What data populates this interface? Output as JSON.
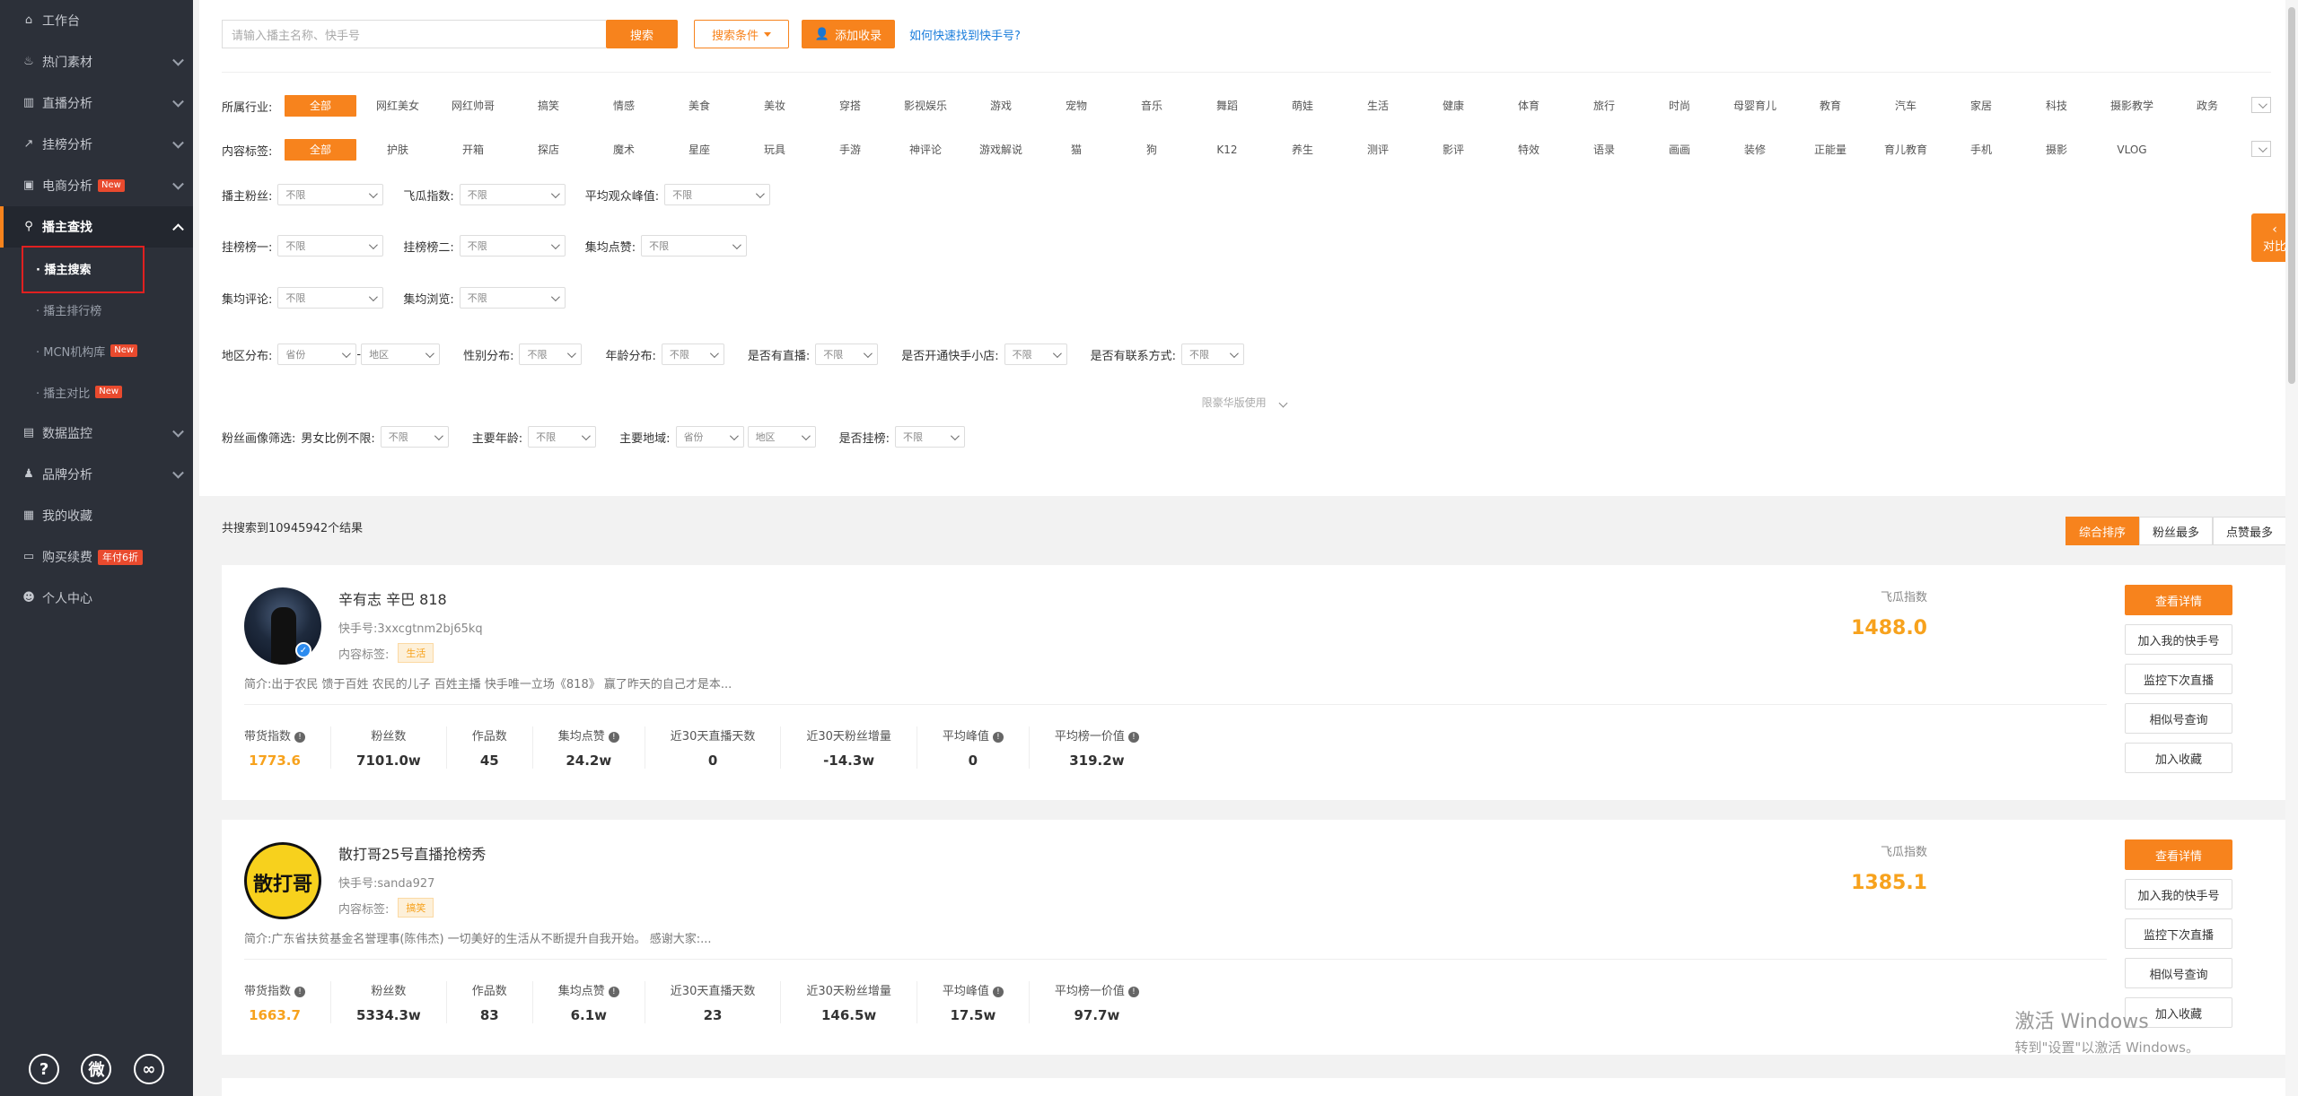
{
  "sidebar": {
    "items": [
      {
        "label": "工作台",
        "icon": "home-icon"
      },
      {
        "label": "热门素材",
        "icon": "fire-icon"
      },
      {
        "label": "直播分析",
        "icon": "bar-chart-icon"
      },
      {
        "label": "挂榜分析",
        "icon": "trend-icon"
      },
      {
        "label": "电商分析",
        "icon": "shop-icon",
        "badge": "New"
      },
      {
        "label": "播主查找",
        "icon": "search-icon"
      },
      {
        "label": "数据监控",
        "icon": "monitor-icon"
      },
      {
        "label": "品牌分析",
        "icon": "brand-icon"
      },
      {
        "label": "我的收藏",
        "icon": "favorite-icon"
      },
      {
        "label": "购买续费",
        "icon": "card-icon",
        "badge": "年付6折"
      },
      {
        "label": "个人中心",
        "icon": "user-icon"
      }
    ],
    "sub": [
      {
        "label": "· 播主搜索"
      },
      {
        "label": "· 播主排行榜"
      },
      {
        "label": "· MCN机构库",
        "badge": "New"
      },
      {
        "label": "· 播主对比",
        "badge": "New"
      }
    ]
  },
  "search": {
    "placeholder": "请输入播主名称、快手号",
    "btn": "搜索",
    "cond": "搜索条件",
    "add": "添加收录",
    "help": "如何快速找到快手号?"
  },
  "industry": {
    "label": "所属行业:",
    "items": [
      "全部",
      "网红美女",
      "网红帅哥",
      "搞笑",
      "情感",
      "美食",
      "美妆",
      "穿搭",
      "影视娱乐",
      "游戏",
      "宠物",
      "音乐",
      "舞蹈",
      "萌娃",
      "生活",
      "健康",
      "体育",
      "旅行",
      "时尚",
      "母婴育儿",
      "教育",
      "汽车",
      "家居",
      "科技",
      "摄影教学",
      "政务"
    ]
  },
  "content": {
    "label": "内容标签:",
    "items": [
      "全部",
      "护肤",
      "开箱",
      "探店",
      "魔术",
      "星座",
      "玩具",
      "手游",
      "神评论",
      "游戏解说",
      "猫",
      "狗",
      "K12",
      "养生",
      "测评",
      "影评",
      "特效",
      "语录",
      "画画",
      "装修",
      "正能量",
      "育儿教育",
      "手机",
      "摄影",
      "VLOG"
    ]
  },
  "filters": {
    "r1": [
      {
        "l": "播主粉丝:",
        "v": "不限"
      },
      {
        "l": "飞瓜指数:",
        "v": "不限"
      },
      {
        "l": "平均观众峰值:",
        "v": "不限"
      }
    ],
    "r2": [
      {
        "l": "挂榜榜一:",
        "v": "不限"
      },
      {
        "l": "挂榜榜二:",
        "v": "不限"
      },
      {
        "l": "集均点赞:",
        "v": "不限"
      }
    ],
    "r3": [
      {
        "l": "集均评论:",
        "v": "不限"
      },
      {
        "l": "集均浏览:",
        "v": "不限"
      }
    ],
    "region_label": "地区分布:",
    "province": "省份",
    "city": "地区",
    "dash": "-",
    "r4": [
      {
        "l": "性别分布:",
        "v": "不限"
      },
      {
        "l": "年龄分布:",
        "v": "不限"
      },
      {
        "l": "是否有直播:",
        "v": "不限"
      },
      {
        "l": "是否开通快手小店:",
        "v": "不限"
      },
      {
        "l": "是否有联系方式:",
        "v": "不限"
      }
    ],
    "hint": "限豪华版使用",
    "fans_label": "粉丝画像筛选:",
    "gender_label": "男女比例不限:",
    "gender_v": "不限",
    "age_label": "主要年龄:",
    "age_v": "不限",
    "region2_label": "主要地域:",
    "province2": "省份",
    "city2": "地区",
    "hang_label": "是否挂榜:",
    "hang_v": "不限"
  },
  "results": {
    "count": "共搜索到10945942个结果",
    "sorts": [
      "综合排序",
      "粉丝最多",
      "点赞最多"
    ]
  },
  "cards": [
    {
      "name": "辛有志 辛巴 818",
      "kid": "快手号:3xxcgtnm2bj65kq",
      "tag_label": "内容标签:",
      "tag": "生活",
      "intro": "简介:出于农民 馈于百姓 农民的儿子 百姓主播 快手唯一立场《818》 赢了昨天的自己才是本...",
      "fg_label": "飞瓜指数",
      "fg": "1488.0",
      "stats": [
        {
          "l": "带货指数",
          "v": "1773.6"
        },
        {
          "l": "粉丝数",
          "v": "7101.0w"
        },
        {
          "l": "作品数",
          "v": "45"
        },
        {
          "l": "集均点赞",
          "v": "24.2w"
        },
        {
          "l": "近30天直播天数",
          "v": "0"
        },
        {
          "l": "近30天粉丝增量",
          "v": "-14.3w"
        },
        {
          "l": "平均峰值",
          "v": "0"
        },
        {
          "l": "平均榜一价值",
          "v": "319.2w"
        }
      ]
    },
    {
      "name": "散打哥25号直播抢榜秀",
      "kid": "快手号:sanda927",
      "tag_label": "内容标签:",
      "tag": "搞笑",
      "intro": "简介:广东省扶贫基金名誉理事(陈伟杰) 一切美好的生活从不断提升自我开始。 感谢大家:...",
      "fg_label": "飞瓜指数",
      "fg": "1385.1",
      "avatar_text": "散打哥",
      "stats": [
        {
          "l": "带货指数",
          "v": "1663.7"
        },
        {
          "l": "粉丝数",
          "v": "5334.3w"
        },
        {
          "l": "作品数",
          "v": "83"
        },
        {
          "l": "集均点赞",
          "v": "6.1w"
        },
        {
          "l": "近30天直播天数",
          "v": "23"
        },
        {
          "l": "近30天粉丝增量",
          "v": "146.5w"
        },
        {
          "l": "平均峰值",
          "v": "17.5w"
        },
        {
          "l": "平均榜一价值",
          "v": "97.7w"
        }
      ]
    }
  ],
  "actions": [
    "查看详情",
    "加入我的快手号",
    "监控下次直播",
    "相似号查询",
    "加入收藏"
  ],
  "compare": "对比",
  "watermark": {
    "l1": "激活 Windows",
    "l2": "转到\"设置\"以激活 Windows。"
  },
  "bottom": {
    "help": "?",
    "wechat": "微",
    "link": "∞"
  }
}
